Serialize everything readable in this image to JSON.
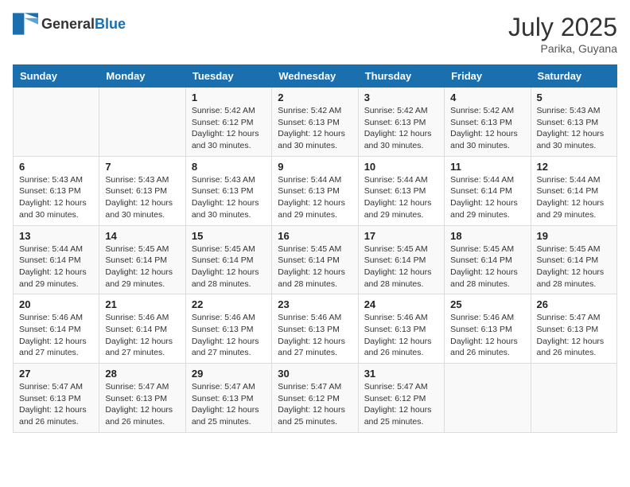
{
  "header": {
    "logo": {
      "general": "General",
      "blue": "Blue"
    },
    "title": "July 2025",
    "location": "Parika, Guyana"
  },
  "weekdays": [
    "Sunday",
    "Monday",
    "Tuesday",
    "Wednesday",
    "Thursday",
    "Friday",
    "Saturday"
  ],
  "weeks": [
    [
      null,
      null,
      {
        "day": 1,
        "sunrise": "5:42 AM",
        "sunset": "6:12 PM",
        "daylight": "12 hours and 30 minutes."
      },
      {
        "day": 2,
        "sunrise": "5:42 AM",
        "sunset": "6:13 PM",
        "daylight": "12 hours and 30 minutes."
      },
      {
        "day": 3,
        "sunrise": "5:42 AM",
        "sunset": "6:13 PM",
        "daylight": "12 hours and 30 minutes."
      },
      {
        "day": 4,
        "sunrise": "5:42 AM",
        "sunset": "6:13 PM",
        "daylight": "12 hours and 30 minutes."
      },
      {
        "day": 5,
        "sunrise": "5:43 AM",
        "sunset": "6:13 PM",
        "daylight": "12 hours and 30 minutes."
      }
    ],
    [
      {
        "day": 6,
        "sunrise": "5:43 AM",
        "sunset": "6:13 PM",
        "daylight": "12 hours and 30 minutes."
      },
      {
        "day": 7,
        "sunrise": "5:43 AM",
        "sunset": "6:13 PM",
        "daylight": "12 hours and 30 minutes."
      },
      {
        "day": 8,
        "sunrise": "5:43 AM",
        "sunset": "6:13 PM",
        "daylight": "12 hours and 30 minutes."
      },
      {
        "day": 9,
        "sunrise": "5:44 AM",
        "sunset": "6:13 PM",
        "daylight": "12 hours and 29 minutes."
      },
      {
        "day": 10,
        "sunrise": "5:44 AM",
        "sunset": "6:13 PM",
        "daylight": "12 hours and 29 minutes."
      },
      {
        "day": 11,
        "sunrise": "5:44 AM",
        "sunset": "6:14 PM",
        "daylight": "12 hours and 29 minutes."
      },
      {
        "day": 12,
        "sunrise": "5:44 AM",
        "sunset": "6:14 PM",
        "daylight": "12 hours and 29 minutes."
      }
    ],
    [
      {
        "day": 13,
        "sunrise": "5:44 AM",
        "sunset": "6:14 PM",
        "daylight": "12 hours and 29 minutes."
      },
      {
        "day": 14,
        "sunrise": "5:45 AM",
        "sunset": "6:14 PM",
        "daylight": "12 hours and 29 minutes."
      },
      {
        "day": 15,
        "sunrise": "5:45 AM",
        "sunset": "6:14 PM",
        "daylight": "12 hours and 28 minutes."
      },
      {
        "day": 16,
        "sunrise": "5:45 AM",
        "sunset": "6:14 PM",
        "daylight": "12 hours and 28 minutes."
      },
      {
        "day": 17,
        "sunrise": "5:45 AM",
        "sunset": "6:14 PM",
        "daylight": "12 hours and 28 minutes."
      },
      {
        "day": 18,
        "sunrise": "5:45 AM",
        "sunset": "6:14 PM",
        "daylight": "12 hours and 28 minutes."
      },
      {
        "day": 19,
        "sunrise": "5:45 AM",
        "sunset": "6:14 PM",
        "daylight": "12 hours and 28 minutes."
      }
    ],
    [
      {
        "day": 20,
        "sunrise": "5:46 AM",
        "sunset": "6:14 PM",
        "daylight": "12 hours and 27 minutes."
      },
      {
        "day": 21,
        "sunrise": "5:46 AM",
        "sunset": "6:14 PM",
        "daylight": "12 hours and 27 minutes."
      },
      {
        "day": 22,
        "sunrise": "5:46 AM",
        "sunset": "6:13 PM",
        "daylight": "12 hours and 27 minutes."
      },
      {
        "day": 23,
        "sunrise": "5:46 AM",
        "sunset": "6:13 PM",
        "daylight": "12 hours and 27 minutes."
      },
      {
        "day": 24,
        "sunrise": "5:46 AM",
        "sunset": "6:13 PM",
        "daylight": "12 hours and 26 minutes."
      },
      {
        "day": 25,
        "sunrise": "5:46 AM",
        "sunset": "6:13 PM",
        "daylight": "12 hours and 26 minutes."
      },
      {
        "day": 26,
        "sunrise": "5:47 AM",
        "sunset": "6:13 PM",
        "daylight": "12 hours and 26 minutes."
      }
    ],
    [
      {
        "day": 27,
        "sunrise": "5:47 AM",
        "sunset": "6:13 PM",
        "daylight": "12 hours and 26 minutes."
      },
      {
        "day": 28,
        "sunrise": "5:47 AM",
        "sunset": "6:13 PM",
        "daylight": "12 hours and 26 minutes."
      },
      {
        "day": 29,
        "sunrise": "5:47 AM",
        "sunset": "6:13 PM",
        "daylight": "12 hours and 25 minutes."
      },
      {
        "day": 30,
        "sunrise": "5:47 AM",
        "sunset": "6:12 PM",
        "daylight": "12 hours and 25 minutes."
      },
      {
        "day": 31,
        "sunrise": "5:47 AM",
        "sunset": "6:12 PM",
        "daylight": "12 hours and 25 minutes."
      },
      null,
      null
    ]
  ]
}
